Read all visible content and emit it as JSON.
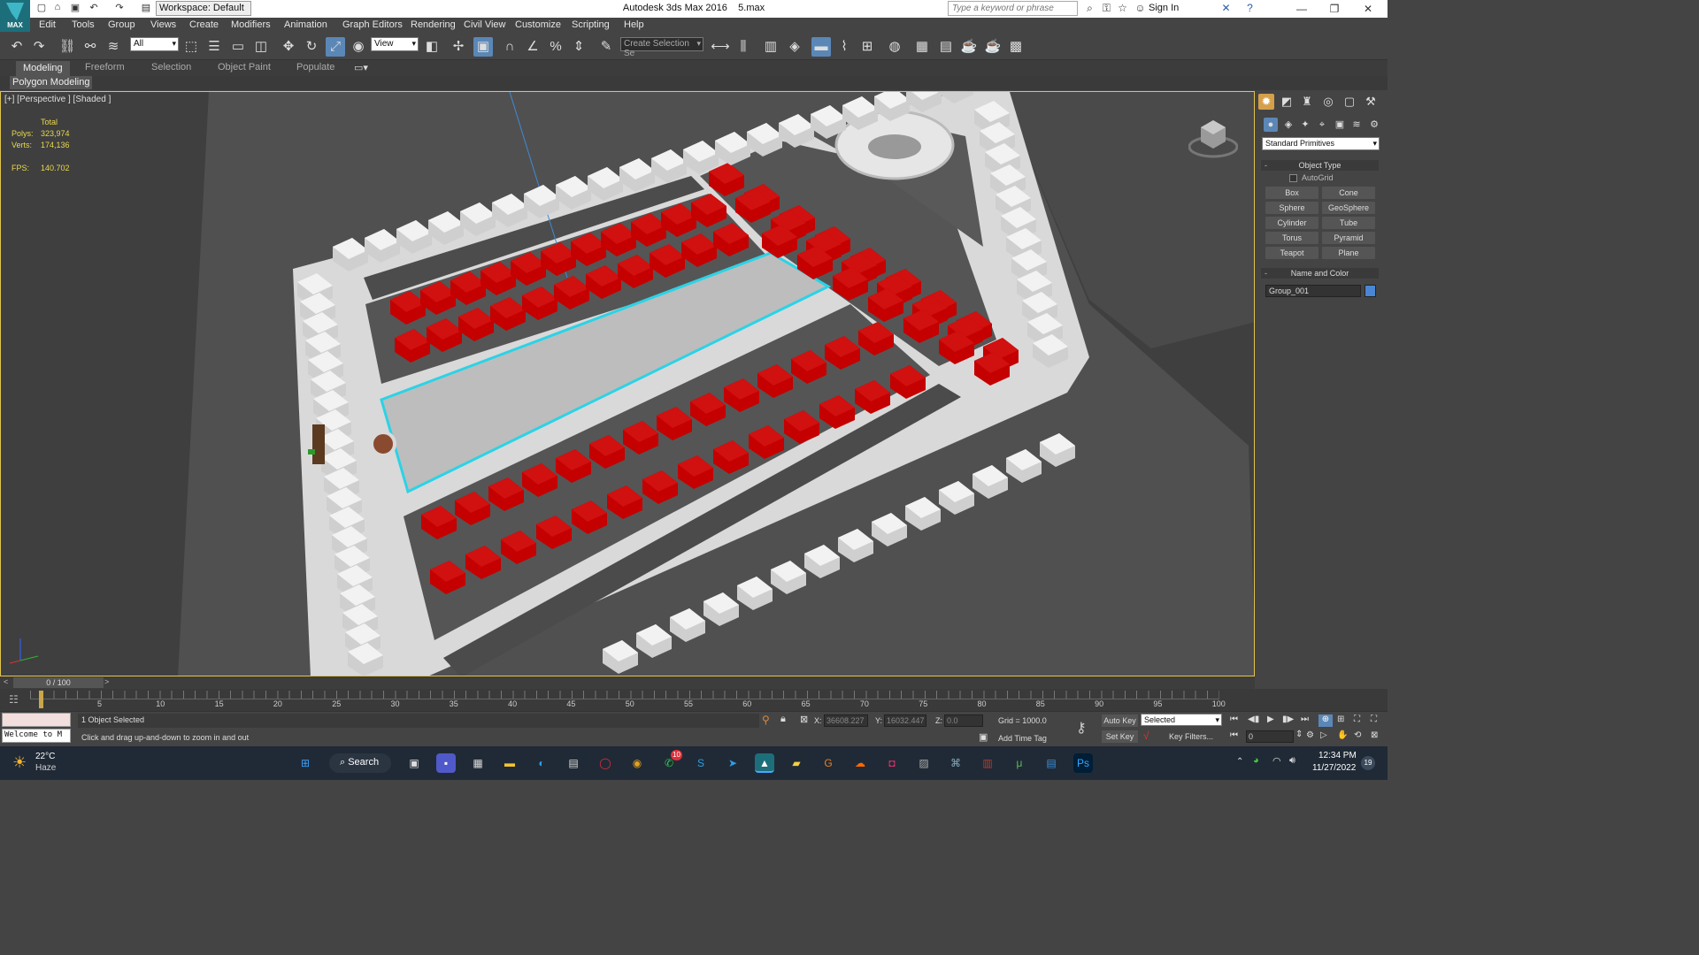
{
  "titlebar": {
    "app_title": "Autodesk 3ds Max 2016",
    "file_name": "5.max",
    "workspace_label": "Workspace: Default",
    "search_placeholder": "Type a keyword or phrase",
    "sign_in_label": "Sign In",
    "logo_text": "MAX"
  },
  "menu": [
    "Edit",
    "Tools",
    "Group",
    "Views",
    "Create",
    "Modifiers",
    "Animation",
    "Graph Editors",
    "Rendering",
    "Civil View",
    "Customize",
    "Scripting",
    "Help"
  ],
  "main_toolbar": {
    "selection_filter": "All",
    "reference_coord": "View",
    "selection_set_placeholder": "Create Selection Se"
  },
  "ribbon": {
    "tabs": [
      "Modeling",
      "Freeform",
      "Selection",
      "Object Paint",
      "Populate"
    ],
    "active_tab": "Modeling",
    "panel_label": "Polygon Modeling"
  },
  "viewport": {
    "label": "[+] [Perspective ] [Shaded ]",
    "stats": {
      "header": "Total",
      "polys_label": "Polys:",
      "polys_value": "323,974",
      "verts_label": "Verts:",
      "verts_value": "174,136",
      "fps_label": "FPS:",
      "fps_value": "140.702"
    }
  },
  "command_panel": {
    "category": "Standard Primitives",
    "object_type_title": "Object Type",
    "autogrid_label": "AutoGrid",
    "primitives": [
      "Box",
      "Cone",
      "Sphere",
      "GeoSphere",
      "Cylinder",
      "Tube",
      "Torus",
      "Pyramid",
      "Teapot",
      "Plane"
    ],
    "name_color_title": "Name and Color",
    "object_name": "Group_001",
    "object_color": "#4a86d4"
  },
  "time": {
    "frame_counter": "0 / 100",
    "ticks": [
      "5",
      "10",
      "15",
      "20",
      "25",
      "30",
      "35",
      "40",
      "45",
      "50",
      "55",
      "60",
      "65",
      "70",
      "75",
      "80",
      "85",
      "90",
      "95",
      "100"
    ]
  },
  "status": {
    "maxscript_text": "Welcome to M",
    "selection_status": "1 Object Selected",
    "prompt": "Click and drag up-and-down to zoom in and out",
    "x_label": "X:",
    "x_value": "36608.227",
    "y_label": "Y:",
    "y_value": "16032.447",
    "z_label": "Z:",
    "z_value": "0.0",
    "grid": "Grid = 1000.0",
    "add_time_tag": "Add Time Tag",
    "auto_key": "Auto Key",
    "set_key": "Set Key",
    "key_mode": "Selected",
    "key_filters": "Key Filters...",
    "current_frame": "0"
  },
  "taskbar": {
    "weather_temp": "22°C",
    "weather_desc": "Haze",
    "search_label": "Search",
    "time": "12:34 PM",
    "date": "11/27/2022",
    "whatsapp_badge": "10",
    "notif_count": "19"
  },
  "colors": {
    "viewport_border": "#e2c44c",
    "house_red": "#c40000",
    "selection_cyan": "#2bd3e6",
    "stats_yellow": "#e9d84c",
    "active_blue": "#5b87b7"
  }
}
